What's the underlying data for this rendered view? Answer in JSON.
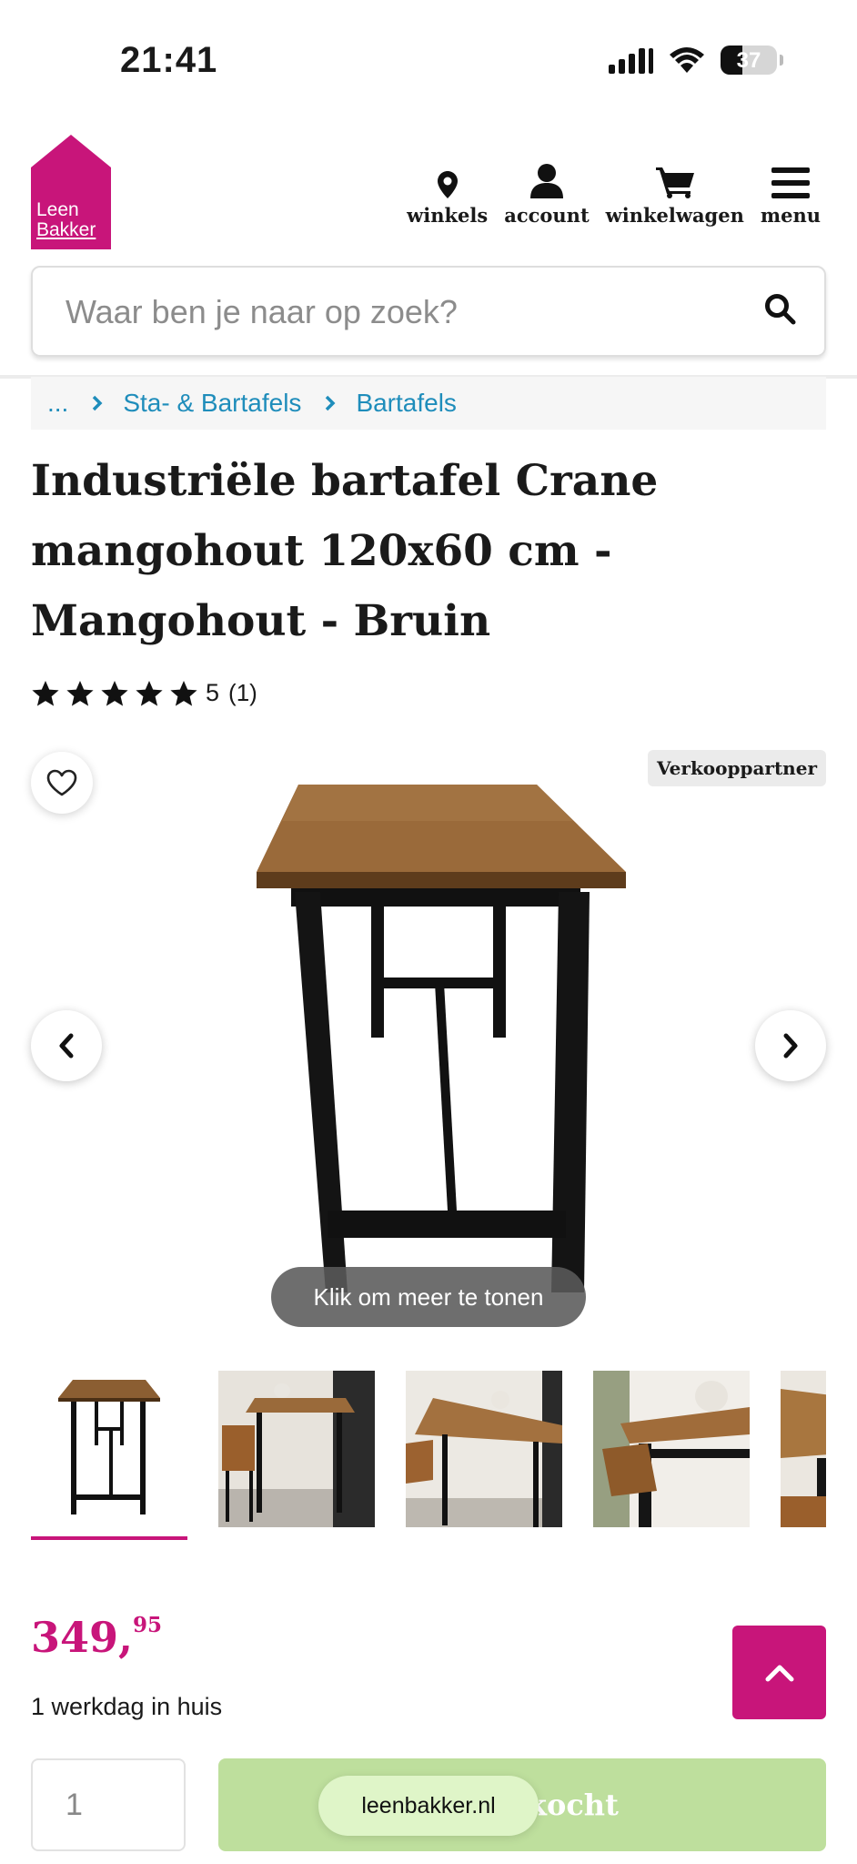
{
  "status_bar": {
    "time": "21:41",
    "battery": "37"
  },
  "header": {
    "logo": {
      "line1": "Leen",
      "line2": "Bakker"
    },
    "nav": [
      {
        "label": "winkels",
        "icon": "map-pin-icon"
      },
      {
        "label": "account",
        "icon": "user-icon"
      },
      {
        "label": "winkelwagen",
        "icon": "cart-icon"
      },
      {
        "label": "menu",
        "icon": "hamburger-icon"
      }
    ],
    "search": {
      "placeholder": "Waar ben je naar op zoek?"
    }
  },
  "breadcrumb": {
    "ellipsis": "...",
    "items": [
      "Sta- & Bartafels",
      "Bartafels"
    ]
  },
  "product": {
    "title": "Industriële bartafel Crane mangohout 120x60 cm - Mangohout - Bruin",
    "rating": {
      "score": "5",
      "count": "(1)",
      "stars": 5
    },
    "badge": "Verkooppartner",
    "image_hint": "Klik om meer te tonen",
    "price": {
      "euros": "349,",
      "cents": "95"
    },
    "delivery": "1 werkdag in huis",
    "quantity": "1",
    "cta": "Uitverkocht"
  },
  "browser": {
    "url": "leenbakker.nl"
  },
  "colors": {
    "brand": "#c8157a",
    "link": "#1f8dbb",
    "cta_disabled": "#bedf9d"
  }
}
